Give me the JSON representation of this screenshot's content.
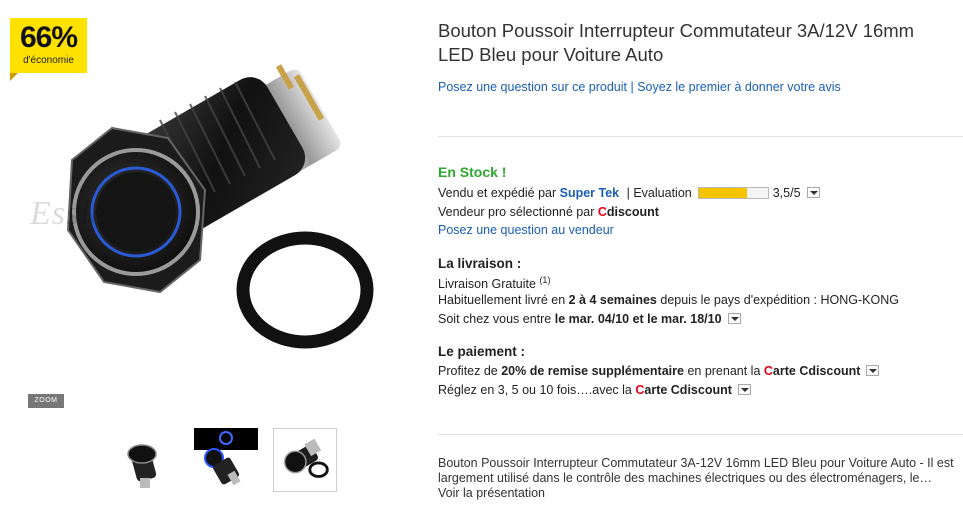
{
  "badge": {
    "percent": "66%",
    "label": "d'économie"
  },
  "image": {
    "watermark": "Essle",
    "zoom_label": "ZOOM"
  },
  "product": {
    "title_line1": "Bouton Poussoir Interrupteur Commutateur 3A/12V 16mm",
    "title_line2": "LED Bleu pour Voiture Auto"
  },
  "links": {
    "ask_question": "Posez une question sur ce produit",
    "separator": " | ",
    "first_review": "Soyez le premier à donner votre avis"
  },
  "stock": {
    "status": "En Stock !"
  },
  "seller": {
    "sold_by_prefix": "Vendu et expédié par ",
    "seller_name": "Super Tek",
    "eval_prefix": "|  Evaluation",
    "rating_text": "3,5/5",
    "rating_fraction": 0.7,
    "pro_prefix": "Vendeur pro sélectionné par ",
    "brand_c": "C",
    "brand_rest": "discount",
    "ask_seller": "Posez une question au vendeur"
  },
  "delivery": {
    "heading": "La livraison :",
    "free": "Livraison Gratuite ",
    "free_note": "(1)",
    "usually_prefix": "Habituellement livré en ",
    "usually_bold": "2 à 4 semaines",
    "usually_suffix": " depuis le pays d'expédition : HONG-KONG",
    "at_home_prefix": "Soit chez vous entre ",
    "at_home_bold": "le mar. 04/10 et le mar. 18/10"
  },
  "payment": {
    "heading": "Le paiement :",
    "line1_prefix": "Profitez de ",
    "line1_bold": "20% de remise supplémentaire",
    "line1_mid": " en prenant la ",
    "card_c": "C",
    "card_rest": "arte Cdiscount",
    "line2_prefix": "Réglez en 3, 5 ou 10 fois….avec la "
  },
  "description": {
    "line1": "Bouton Poussoir Interrupteur Commutateur 3A-12V 16mm LED Bleu pour Voiture Auto - Il est",
    "line2": "largement utilisé dans le contrôle des machines électriques ou des électroménagers, le…",
    "more": "Voir la présentation"
  },
  "colors": {
    "accent_link": "#1a5fb4",
    "stock_green": "#2fa82f",
    "brand_red": "#e2001a",
    "badge_yellow": "#ffe100",
    "rating_fill": "#f5c400"
  }
}
